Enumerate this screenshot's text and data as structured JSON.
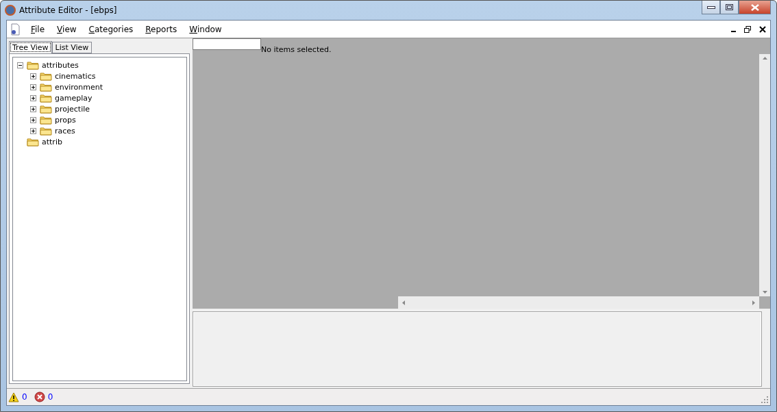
{
  "window": {
    "title": "Attribute Editor - [ebps]"
  },
  "menu": [
    {
      "label": "File"
    },
    {
      "label": "View"
    },
    {
      "label": "Categories"
    },
    {
      "label": "Reports"
    },
    {
      "label": "Window"
    }
  ],
  "tabs": [
    {
      "label": "Tree View",
      "selected": true
    },
    {
      "label": "List View",
      "selected": false
    }
  ],
  "tree": [
    {
      "label": "attributes",
      "expanded": true,
      "children": [
        {
          "label": "cinematics",
          "expanded": false
        },
        {
          "label": "environment",
          "expanded": false
        },
        {
          "label": "gameplay",
          "expanded": false
        },
        {
          "label": "projectile",
          "expanded": false
        },
        {
          "label": "props",
          "expanded": false
        },
        {
          "label": "races",
          "expanded": false
        }
      ]
    },
    {
      "label": "attrib"
    }
  ],
  "selection": {
    "message": "No items selected."
  },
  "status_bar": {
    "warnings": "0",
    "errors": "0"
  }
}
